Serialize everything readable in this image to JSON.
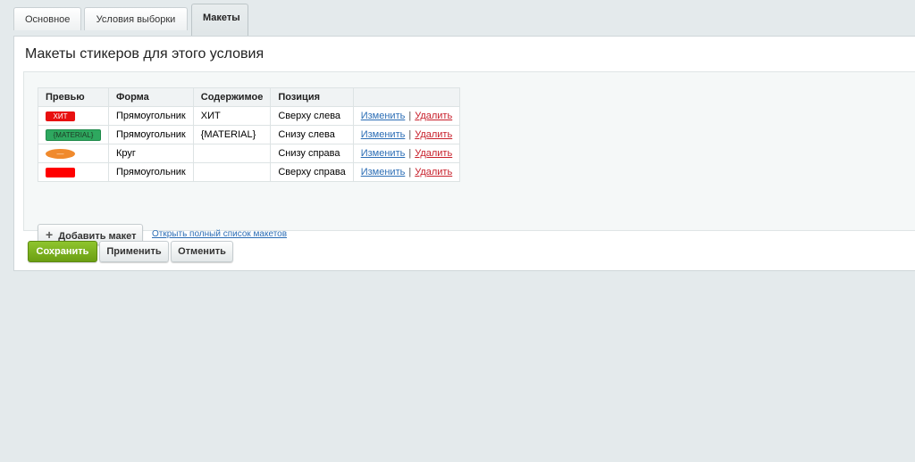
{
  "tabs": [
    {
      "label": "Основное"
    },
    {
      "label": "Условия выборки"
    },
    {
      "label": "Макеты"
    }
  ],
  "panel": {
    "title": "Макеты стикеров для этого условия"
  },
  "table": {
    "headers": [
      "Превью",
      "Форма",
      "Содержимое",
      "Позиция",
      ""
    ],
    "rows": [
      {
        "preview": "ХИТ",
        "preview_color": "#e81010",
        "form": "Прямоугольник",
        "content": "ХИТ",
        "position": "Сверху слева",
        "edit": "Изменить",
        "delete": "Удалить"
      },
      {
        "preview": "{MATERIAL}",
        "preview_color": "#2ea85f",
        "form": "Прямоугольник",
        "content": "{MATERIAL}",
        "position": "Снизу слева",
        "edit": "Изменить",
        "delete": "Удалить"
      },
      {
        "preview": "—",
        "preview_color": "#f08a2d",
        "form": "Круг",
        "content": "",
        "position": "Снизу справа",
        "edit": "Изменить",
        "delete": "Удалить"
      },
      {
        "preview": "",
        "preview_color": "#ff0000",
        "form": "Прямоугольник",
        "content": "",
        "position": "Сверху справа",
        "edit": "Изменить",
        "delete": "Удалить"
      }
    ],
    "separator": "|"
  },
  "actions": {
    "add_label": "Добавить макет",
    "full_list_link": "Открыть полный список макетов"
  },
  "buttons": {
    "save": "Сохранить",
    "apply": "Применить",
    "cancel": "Отменить"
  }
}
